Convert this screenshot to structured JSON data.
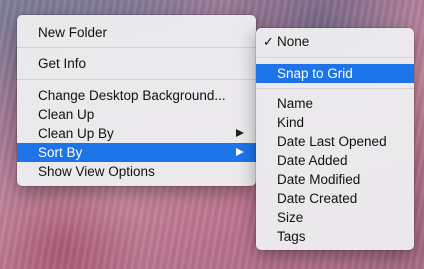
{
  "context_menu": {
    "items": [
      {
        "label": "New Folder"
      },
      {
        "label": "Get Info"
      },
      {
        "label": "Change Desktop Background..."
      },
      {
        "label": "Clean Up"
      },
      {
        "label": "Clean Up By",
        "has_submenu": true
      },
      {
        "label": "Sort By",
        "has_submenu": true,
        "highlighted": true
      },
      {
        "label": "Show View Options"
      }
    ]
  },
  "sort_submenu": {
    "check_mark": "✓",
    "items": [
      {
        "label": "None",
        "checked": true
      },
      {
        "label": "Snap to Grid",
        "highlighted": true
      },
      {
        "label": "Name"
      },
      {
        "label": "Kind"
      },
      {
        "label": "Date Last Opened"
      },
      {
        "label": "Date Added"
      },
      {
        "label": "Date Modified"
      },
      {
        "label": "Date Created"
      },
      {
        "label": "Size"
      },
      {
        "label": "Tags"
      }
    ]
  },
  "colors": {
    "highlight": "#1c74e8",
    "menu_background": "#ececee"
  }
}
